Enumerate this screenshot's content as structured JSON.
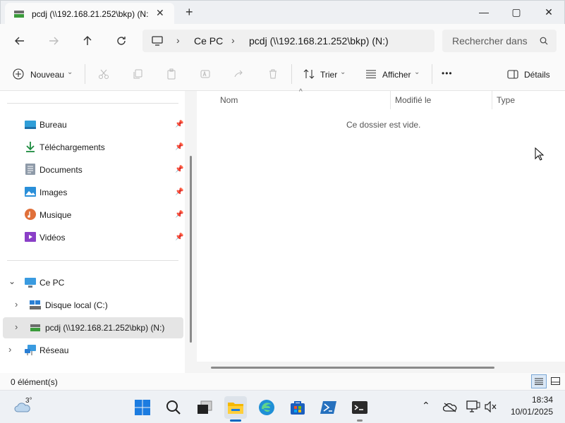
{
  "window": {
    "tab_title": "pcdj (\\\\192.168.21.252\\bkp) (N:",
    "new_tab_symbol": "+",
    "minimize_symbol": "—",
    "maximize_symbol": "▢",
    "close_symbol": "✕"
  },
  "address": {
    "crumbs": [
      "Ce PC",
      "pcdj (\\\\192.168.21.252\\bkp) (N:)"
    ],
    "search_placeholder": "Rechercher dans"
  },
  "toolbar": {
    "new_label": "Nouveau",
    "sort_label": "Trier",
    "view_label": "Afficher",
    "more_label": "•••",
    "details_label": "Détails"
  },
  "sidebar": {
    "quick_items": [
      {
        "label": "Bureau",
        "icon": "desktop-icon"
      },
      {
        "label": "Téléchargements",
        "icon": "download-icon"
      },
      {
        "label": "Documents",
        "icon": "documents-icon"
      },
      {
        "label": "Images",
        "icon": "images-icon"
      },
      {
        "label": "Musique",
        "icon": "music-icon"
      },
      {
        "label": "Vidéos",
        "icon": "videos-icon"
      }
    ],
    "this_pc": "Ce PC",
    "drive_c": "Disque local (C:)",
    "drive_n": "pcdj (\\\\192.168.21.252\\bkp) (N:)",
    "network": "Réseau"
  },
  "content": {
    "columns": [
      "Nom",
      "Modifié le",
      "Type"
    ],
    "empty_message": "Ce dossier est vide."
  },
  "status": {
    "item_count": "0 élément(s)"
  },
  "taskbar": {
    "weather_temp": "3°",
    "time": "18:34",
    "date": "10/01/2025"
  },
  "colors": {
    "accent": "#0067c0",
    "selected_bg": "#e5e5e5",
    "win_blue": "#1a73e8"
  }
}
